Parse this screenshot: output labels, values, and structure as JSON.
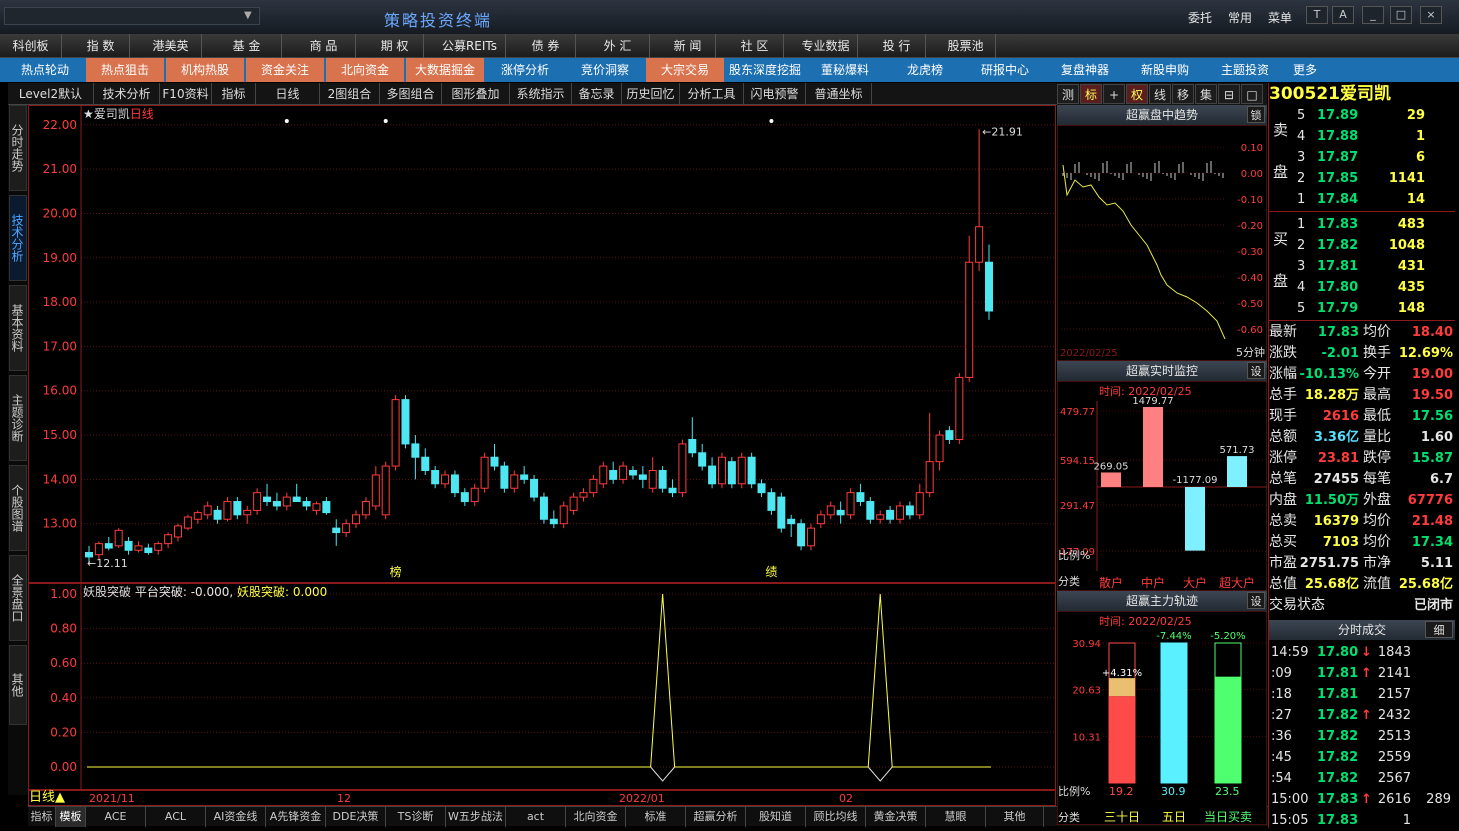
{
  "window": {
    "title": "策略投资终端",
    "search_placeholder": "",
    "top_links": [
      "委托",
      "常用",
      "菜单"
    ],
    "window_buttons": [
      "T",
      "A",
      "_",
      "□",
      "×"
    ]
  },
  "menubar": [
    "科创板",
    "指 数",
    "港美英",
    "基 金",
    "商 品",
    "期 权",
    "公募REITs",
    "债 券",
    "外 汇",
    "新 闻",
    "社 区",
    "专业数据",
    "投 行",
    "股票池"
  ],
  "navbar": [
    {
      "label": "热点轮动",
      "hot": false
    },
    {
      "label": "热点狙击",
      "hot": true
    },
    {
      "label": "机构热股",
      "hot": true
    },
    {
      "label": "资金关注",
      "hot": true
    },
    {
      "label": "北向资金",
      "hot": true
    },
    {
      "label": "大数据掘金",
      "hot": true
    },
    {
      "label": "涨停分析",
      "hot": false
    },
    {
      "label": "竞价洞察",
      "hot": false
    },
    {
      "label": "大宗交易",
      "hot": true
    },
    {
      "label": "股东深度挖掘",
      "hot": false
    },
    {
      "label": "董秘爆料",
      "hot": false
    },
    {
      "label": "龙虎榜",
      "hot": false
    },
    {
      "label": "研报中心",
      "hot": false
    },
    {
      "label": "复盘神器",
      "hot": false
    },
    {
      "label": "新股申购",
      "hot": false
    },
    {
      "label": "主题投资",
      "hot": false
    },
    {
      "label": "更多",
      "hot": false
    }
  ],
  "toolbar": [
    "Level2默认",
    "技术分析",
    "F10资料",
    "指标",
    "日线",
    "2图组合",
    "多图组合",
    "图形叠加",
    "系统指示",
    "备忘录",
    "历史回忆",
    "分析工具",
    "闪电预警",
    "普通坐标"
  ],
  "right_tabs": [
    "测",
    "标",
    "+",
    "权",
    "线",
    "移",
    "集",
    "⊟",
    "□"
  ],
  "vertical_tabs": [
    "分时走势",
    "技术分析",
    "基本资料",
    "主题诊断",
    "个股图谱",
    "全景盘口",
    "其他"
  ],
  "main_chart": {
    "stock_label": "★爱司凯",
    "period_label": "日线",
    "y_ticks": [
      "22.00",
      "21.00",
      "20.00",
      "19.00",
      "18.00",
      "17.00",
      "16.00",
      "15.00",
      "14.00",
      "13.00"
    ],
    "high_label": "←21.91",
    "low_label": "←12.11",
    "markers": [
      {
        "text": "榜"
      },
      {
        "text": "绩"
      }
    ]
  },
  "chart_data": {
    "type": "candlestick",
    "ylim": [
      12.0,
      22.2
    ],
    "candles": [
      [
        12.35,
        12.5,
        12.1,
        12.25
      ],
      [
        12.3,
        12.6,
        12.2,
        12.55
      ],
      [
        12.55,
        12.7,
        12.4,
        12.45
      ],
      [
        12.5,
        12.9,
        12.45,
        12.85
      ],
      [
        12.6,
        12.7,
        12.3,
        12.4
      ],
      [
        12.4,
        12.6,
        12.35,
        12.5
      ],
      [
        12.45,
        12.55,
        12.3,
        12.35
      ],
      [
        12.4,
        12.6,
        12.3,
        12.55
      ],
      [
        12.55,
        12.8,
        12.45,
        12.75
      ],
      [
        12.7,
        13.0,
        12.6,
        12.95
      ],
      [
        12.9,
        13.2,
        12.85,
        13.15
      ],
      [
        13.1,
        13.3,
        13.0,
        13.25
      ],
      [
        13.2,
        13.5,
        13.1,
        13.4
      ],
      [
        13.3,
        13.4,
        13.0,
        13.1
      ],
      [
        13.1,
        13.6,
        13.05,
        13.5
      ],
      [
        13.5,
        13.6,
        13.1,
        13.2
      ],
      [
        13.2,
        13.4,
        13.0,
        13.3
      ],
      [
        13.3,
        13.8,
        13.2,
        13.7
      ],
      [
        13.6,
        13.9,
        13.4,
        13.5
      ],
      [
        13.5,
        13.7,
        13.3,
        13.4
      ],
      [
        13.4,
        13.7,
        13.3,
        13.6
      ],
      [
        13.6,
        13.9,
        13.5,
        13.5
      ],
      [
        13.5,
        13.6,
        13.3,
        13.4
      ],
      [
        13.3,
        13.5,
        13.2,
        13.45
      ],
      [
        13.5,
        13.6,
        13.2,
        13.25
      ],
      [
        12.9,
        13.1,
        12.5,
        12.8
      ],
      [
        12.8,
        13.1,
        12.7,
        13.0
      ],
      [
        13.0,
        13.3,
        12.9,
        13.2
      ],
      [
        13.2,
        13.6,
        13.1,
        13.5
      ],
      [
        13.4,
        14.3,
        13.3,
        14.1
      ],
      [
        13.2,
        14.4,
        13.1,
        14.3
      ],
      [
        14.3,
        15.9,
        14.2,
        15.8
      ],
      [
        15.8,
        15.9,
        14.7,
        14.8
      ],
      [
        14.8,
        15.0,
        14.0,
        14.5
      ],
      [
        14.5,
        14.7,
        14.1,
        14.2
      ],
      [
        14.2,
        14.3,
        13.8,
        13.9
      ],
      [
        13.9,
        14.2,
        13.8,
        14.1
      ],
      [
        14.1,
        14.2,
        13.6,
        13.7
      ],
      [
        13.7,
        13.8,
        13.4,
        13.5
      ],
      [
        13.5,
        13.9,
        13.4,
        13.8
      ],
      [
        13.8,
        14.6,
        13.7,
        14.5
      ],
      [
        14.5,
        14.8,
        14.2,
        14.3
      ],
      [
        14.3,
        14.4,
        13.7,
        13.8
      ],
      [
        13.8,
        14.2,
        13.7,
        14.1
      ],
      [
        14.1,
        14.3,
        13.9,
        14.0
      ],
      [
        14.0,
        14.1,
        13.5,
        13.6
      ],
      [
        13.6,
        13.7,
        13.0,
        13.1
      ],
      [
        13.1,
        13.3,
        12.9,
        13.0
      ],
      [
        13.0,
        13.5,
        12.9,
        13.4
      ],
      [
        13.3,
        13.7,
        13.2,
        13.6
      ],
      [
        13.6,
        13.8,
        13.5,
        13.7
      ],
      [
        13.7,
        14.1,
        13.6,
        14.0
      ],
      [
        13.9,
        14.4,
        13.8,
        14.3
      ],
      [
        14.2,
        14.4,
        13.9,
        14.0
      ],
      [
        14.0,
        14.4,
        13.9,
        14.3
      ],
      [
        14.2,
        14.3,
        14.0,
        14.1
      ],
      [
        14.1,
        14.3,
        13.8,
        14.0
      ],
      [
        13.8,
        14.5,
        13.7,
        14.2
      ],
      [
        14.2,
        14.3,
        13.7,
        13.8
      ],
      [
        13.8,
        14.0,
        13.6,
        13.7
      ],
      [
        13.7,
        14.9,
        13.6,
        14.8
      ],
      [
        14.9,
        15.4,
        14.5,
        14.6
      ],
      [
        14.6,
        14.8,
        14.2,
        14.3
      ],
      [
        14.3,
        14.5,
        13.8,
        13.9
      ],
      [
        13.9,
        14.6,
        13.8,
        14.5
      ],
      [
        14.4,
        14.5,
        13.8,
        13.9
      ],
      [
        13.9,
        14.6,
        13.8,
        14.5
      ],
      [
        14.5,
        14.6,
        13.8,
        13.9
      ],
      [
        13.9,
        14.0,
        13.6,
        13.7
      ],
      [
        13.7,
        13.8,
        13.2,
        13.3
      ],
      [
        13.6,
        13.7,
        12.8,
        12.9
      ],
      [
        13.1,
        13.2,
        12.7,
        13.0
      ],
      [
        13.0,
        13.1,
        12.4,
        12.5
      ],
      [
        12.5,
        13.0,
        12.4,
        12.9
      ],
      [
        13.0,
        13.3,
        12.9,
        13.2
      ],
      [
        13.2,
        13.5,
        13.1,
        13.4
      ],
      [
        13.3,
        13.5,
        13.0,
        13.2
      ],
      [
        13.2,
        13.8,
        13.1,
        13.7
      ],
      [
        13.7,
        13.9,
        13.4,
        13.5
      ],
      [
        13.5,
        13.6,
        13.0,
        13.1
      ],
      [
        13.1,
        13.3,
        13.0,
        13.2
      ],
      [
        13.3,
        13.4,
        13.0,
        13.1
      ],
      [
        13.1,
        13.5,
        13.0,
        13.4
      ],
      [
        13.4,
        13.5,
        13.1,
        13.2
      ],
      [
        13.2,
        13.9,
        13.1,
        13.7
      ],
      [
        13.7,
        15.5,
        13.6,
        14.4
      ],
      [
        14.4,
        15.1,
        14.2,
        15.0
      ],
      [
        15.1,
        15.2,
        14.8,
        14.9
      ],
      [
        14.9,
        16.4,
        14.8,
        16.3
      ],
      [
        16.3,
        19.5,
        16.2,
        18.9
      ],
      [
        18.9,
        21.9,
        18.7,
        19.7
      ],
      [
        18.9,
        19.3,
        17.6,
        17.8
      ]
    ]
  },
  "indicator": {
    "name": "妖股突破",
    "line1": "平台突破: -0.000,",
    "line2": "妖股突破: 0.000",
    "y_ticks": [
      "1.00",
      "0.80",
      "0.60",
      "0.40",
      "0.20",
      "0.00"
    ],
    "spikes": [
      58,
      80
    ]
  },
  "time_axis": {
    "period": "日线▲",
    "labels": [
      "2021/11",
      "12",
      "2022/01",
      "02"
    ]
  },
  "bottom_tabs": [
    "指标",
    "模板",
    "ACE",
    "ACL",
    "AI资金线",
    "A先锋资金",
    "DDE决策",
    "TS诊断",
    "W五步战法",
    "act",
    "北向资金",
    "标准",
    "超赢分析",
    "股知道",
    "顾比均线",
    "黄金决策",
    "慧眼",
    "其他"
  ],
  "panel_trend": {
    "title": "超赢盘中趋势",
    "btn": "锁",
    "y_ticks": [
      "0.10",
      "0.00",
      "-0.10",
      "-0.20",
      "-0.30",
      "-0.40",
      "-0.50",
      "-0.60"
    ],
    "date": "2022/02/25",
    "period": "5分钟"
  },
  "panel_monitor": {
    "title": "超赢实时监控",
    "btn": "设",
    "time_label": "时间: 2022/02/25",
    "y_ticks": [
      "479.77",
      "594.15",
      "291.47",
      "177.09"
    ],
    "bars": [
      {
        "label": "散户",
        "value": 269.05
      },
      {
        "label": "中户",
        "value": 1479.77
      },
      {
        "label": "大户",
        "value": -1177.09
      },
      {
        "label": "超大户",
        "value": 571.73
      }
    ],
    "value_labels": [
      "269.05",
      "1479.77",
      "-1177.09",
      "571.73"
    ],
    "ratio_label": "比例%",
    "cat_label": "分类"
  },
  "panel_track": {
    "title": "超赢主力轨迹",
    "btn": "设",
    "time_label": "时间: 2022/02/25",
    "y_ticks": [
      "30.94",
      "20.63",
      "10.31"
    ],
    "bars": [
      {
        "label": "三十日",
        "value": 19.2,
        "pct": "+4.31%"
      },
      {
        "label": "五日",
        "value": 30.9,
        "pct": "-7.44%"
      },
      {
        "label": "当日买卖",
        "value": 23.5,
        "pct": "-5.20%"
      }
    ],
    "bottom_values": [
      "19.2",
      "30.9",
      "23.5"
    ],
    "ratio_label": "比例%",
    "cat_label": "分类"
  },
  "quote": {
    "code": "300521",
    "name": "爱司凯",
    "sell_label": [
      "卖",
      "盘"
    ],
    "buy_label": [
      "买",
      "盘"
    ],
    "asks": [
      {
        "lvl": "5",
        "p": "17.89",
        "v": "29"
      },
      {
        "lvl": "4",
        "p": "17.88",
        "v": "1"
      },
      {
        "lvl": "3",
        "p": "17.87",
        "v": "6"
      },
      {
        "lvl": "2",
        "p": "17.85",
        "v": "1141"
      },
      {
        "lvl": "1",
        "p": "17.84",
        "v": "14"
      }
    ],
    "bids": [
      {
        "lvl": "1",
        "p": "17.83",
        "v": "483"
      },
      {
        "lvl": "2",
        "p": "17.82",
        "v": "1048"
      },
      {
        "lvl": "3",
        "p": "17.81",
        "v": "431"
      },
      {
        "lvl": "4",
        "p": "17.80",
        "v": "435"
      },
      {
        "lvl": "5",
        "p": "17.79",
        "v": "148"
      }
    ],
    "stats": [
      {
        "l1": "最新",
        "v1": "17.83",
        "c1": "grn",
        "l2": "均价",
        "v2": "18.40",
        "c2": "red"
      },
      {
        "l1": "涨跌",
        "v1": "-2.01",
        "c1": "grn",
        "l2": "换手",
        "v2": "12.69%",
        "c2": "yel"
      },
      {
        "l1": "涨幅",
        "v1": "-10.13%",
        "c1": "grn",
        "l2": "今开",
        "v2": "19.00",
        "c2": "red"
      },
      {
        "l1": "总手",
        "v1": "18.28万",
        "c1": "yel",
        "l2": "最高",
        "v2": "19.50",
        "c2": "red"
      },
      {
        "l1": "现手",
        "v1": "2616",
        "c1": "red",
        "l2": "最低",
        "v2": "17.56",
        "c2": "grn"
      },
      {
        "l1": "总额",
        "v1": "3.36亿",
        "c1": "cyn",
        "l2": "量比",
        "v2": "1.60",
        "c2": "wht"
      },
      {
        "l1": "涨停",
        "v1": "23.81",
        "c1": "red",
        "l2": "跌停",
        "v2": "15.87",
        "c2": "grn"
      },
      {
        "l1": "总笔",
        "v1": "27455",
        "c1": "wht",
        "l2": "每笔",
        "v2": "6.7",
        "c2": "wht"
      },
      {
        "l1": "内盘",
        "v1": "11.50万",
        "c1": "grn",
        "l2": "外盘",
        "v2": "67776",
        "c2": "red"
      },
      {
        "l1": "总卖",
        "v1": "16379",
        "c1": "yel",
        "l2": "均价",
        "v2": "21.48",
        "c2": "red"
      },
      {
        "l1": "总买",
        "v1": "7103",
        "c1": "yel",
        "l2": "均价",
        "v2": "17.34",
        "c2": "grn"
      },
      {
        "l1": "市盈",
        "v1": "2751.75",
        "c1": "wht",
        "l2": "市净",
        "v2": "5.11",
        "c2": "wht"
      },
      {
        "l1": "总值",
        "v1": "25.68亿",
        "c1": "yel",
        "l2": "流值",
        "v2": "25.68亿",
        "c2": "yel"
      },
      {
        "l1": "交易状态",
        "v1": "",
        "c1": "wht",
        "l2": "",
        "v2": "已闭市",
        "c2": "wht"
      }
    ],
    "ticks_header": "分时成交",
    "ticks_btn": "细",
    "ticks": [
      {
        "t": "14:59",
        "p": "17.80",
        "dir": "↓",
        "v": "1843",
        "v2": ""
      },
      {
        "t": ":09",
        "p": "17.81",
        "dir": "↑",
        "v": "2141",
        "v2": ""
      },
      {
        "t": ":18",
        "p": "17.81",
        "dir": "",
        "v": "2157",
        "v2": ""
      },
      {
        "t": ":27",
        "p": "17.82",
        "dir": "↑",
        "v": "2432",
        "v2": ""
      },
      {
        "t": ":36",
        "p": "17.82",
        "dir": "",
        "v": "2513",
        "v2": ""
      },
      {
        "t": ":45",
        "p": "17.82",
        "dir": "",
        "v": "2559",
        "v2": ""
      },
      {
        "t": ":54",
        "p": "17.82",
        "dir": "",
        "v": "2567",
        "v2": ""
      },
      {
        "t": "15:00",
        "p": "17.83",
        "dir": "↑",
        "v": "2616",
        "v2": "289"
      },
      {
        "t": "15:05",
        "p": "17.83",
        "dir": "",
        "v": "1",
        "v2": ""
      }
    ]
  },
  "colors": {
    "up": "#ff3b3b",
    "down": "#4ee6f0",
    "frame": "#8b1a1a",
    "accent": "#1c6fb0",
    "hot": "#d9734e"
  }
}
